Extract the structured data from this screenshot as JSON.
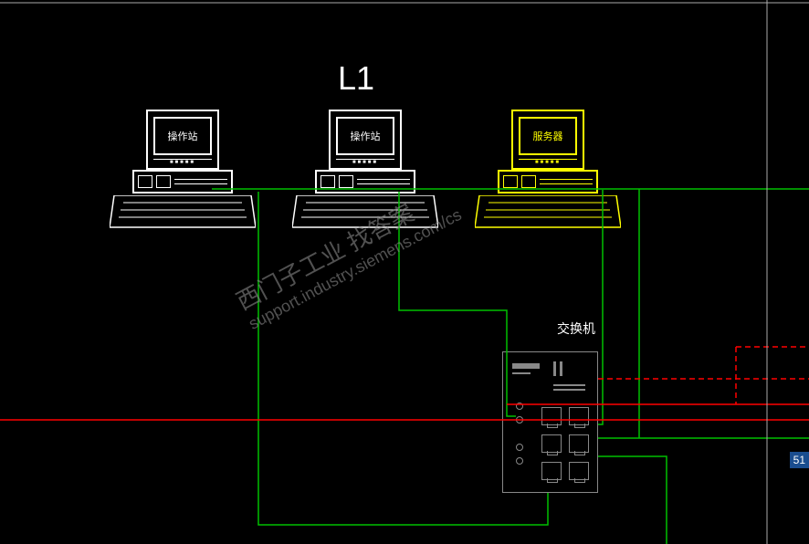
{
  "title": "L1",
  "workstations": {
    "ws1": {
      "label": "操作站",
      "color": "white"
    },
    "ws2": {
      "label": "操作站",
      "color": "white"
    },
    "ws3": {
      "label": "服务器",
      "color": "yellow"
    }
  },
  "switch": {
    "label": "交换机"
  },
  "watermark": {
    "main": "西门子工业  找答案",
    "sub": "support.industry.siemens.com/cs"
  },
  "page_badge": "51",
  "wires": {
    "green": "#00c000",
    "red": "#ff0000"
  }
}
